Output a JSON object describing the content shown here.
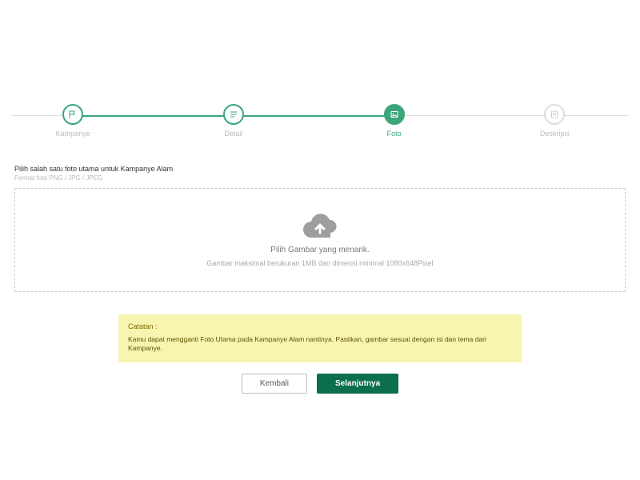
{
  "stepper": {
    "steps": [
      {
        "label": "Kampanye"
      },
      {
        "label": "Detail"
      },
      {
        "label": "Foto"
      },
      {
        "label": "Deskripsi"
      }
    ],
    "active_index": 2
  },
  "upload": {
    "heading": "Pilih salah satu foto utama untuk Kampanye Alam",
    "subheading": "Format foto PNG / JPG / JPEG",
    "dropzone_title": "Pilih Gambar yang menarik.",
    "dropzone_subtitle": "Gambar maksimal berukuran 1MB dan dimensi minimal 1080x648Pixel"
  },
  "note": {
    "title": "Catatan :",
    "body": "Kamu dapat mengganti Foto Utama pada Kampanye Alam nantinya. Pastikan, gambar sesuai dengan isi dan tema dari Kampanye."
  },
  "buttons": {
    "back": "Kembali",
    "next": "Selanjutnya"
  },
  "colors": {
    "accent": "#0b6e4f",
    "step": "#3aa67a",
    "note_bg": "#f8f5b0"
  }
}
